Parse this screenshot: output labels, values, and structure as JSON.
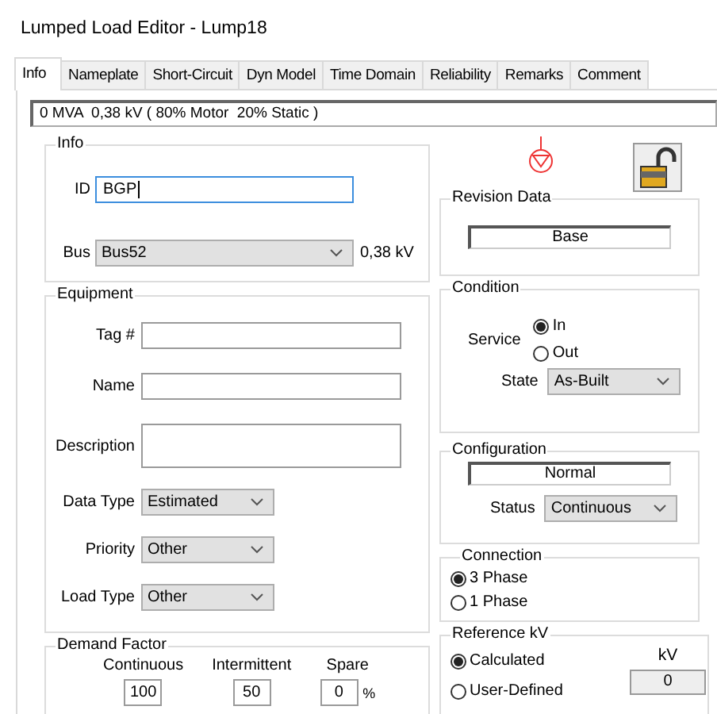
{
  "window": {
    "title": "Lumped Load Editor - Lump18"
  },
  "tabs": [
    {
      "label": "Info",
      "selected": true
    },
    {
      "label": "Nameplate",
      "selected": false
    },
    {
      "label": "Short-Circuit",
      "selected": false
    },
    {
      "label": "Dyn Model",
      "selected": false
    },
    {
      "label": "Time Domain",
      "selected": false
    },
    {
      "label": "Reliability",
      "selected": false
    },
    {
      "label": "Remarks",
      "selected": false
    },
    {
      "label": "Comment",
      "selected": false
    }
  ],
  "summary": "0 MVA  0,38 kV ( 80% Motor  20% Static )",
  "info": {
    "title": "Info",
    "id": {
      "label": "ID",
      "value": "BGP"
    },
    "bus": {
      "label": "Bus",
      "value": "Bus52",
      "unit": "0,38 kV"
    }
  },
  "equipment": {
    "title": "Equipment",
    "fields": [
      {
        "kind": "text",
        "label": "Tag #"
      },
      {
        "kind": "text",
        "label": "Name"
      },
      {
        "kind": "textarea",
        "label": "Description"
      },
      {
        "kind": "select",
        "label": "Data Type",
        "value": "Estimated"
      },
      {
        "kind": "select",
        "label": "Priority",
        "value": "Other"
      },
      {
        "kind": "select",
        "label": "Load Type",
        "value": "Other"
      }
    ]
  },
  "demand_factor": {
    "title": "Demand Factor",
    "columns": [
      {
        "label": "Continuous",
        "value": "100"
      },
      {
        "label": "Intermittent",
        "value": "50"
      },
      {
        "label": "Spare",
        "value": "0",
        "unit": "%"
      }
    ]
  },
  "revision_data": {
    "title": "Revision Data",
    "value": "Base"
  },
  "condition": {
    "title": "Condition",
    "service": {
      "label": "Service",
      "options": [
        {
          "label": "In",
          "selected": true
        },
        {
          "label": "Out",
          "selected": false
        }
      ]
    },
    "state": {
      "label": "State",
      "value": "As-Built"
    }
  },
  "configuration": {
    "title": "Configuration",
    "value": "Normal",
    "status": {
      "label": "Status",
      "value": "Continuous"
    }
  },
  "connection": {
    "title": "Connection",
    "options": [
      {
        "label": "3 Phase",
        "selected": true
      },
      {
        "label": "1 Phase",
        "selected": false
      }
    ]
  },
  "reference_kv": {
    "title": "Reference kV",
    "options": [
      {
        "label": "Calculated",
        "selected": true
      },
      {
        "label": "User-Defined",
        "selected": false
      }
    ],
    "unit": "kV",
    "value": "0"
  }
}
